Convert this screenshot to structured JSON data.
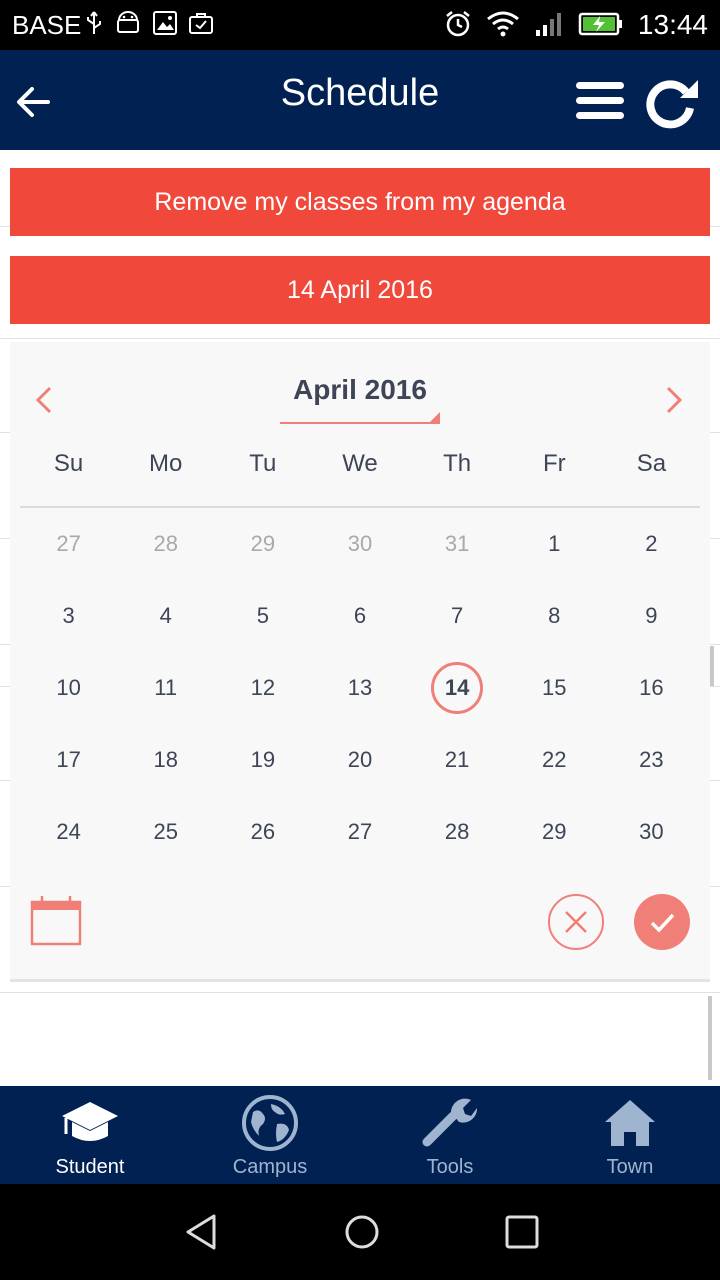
{
  "status_bar": {
    "carrier": "BASE",
    "time": "13:44",
    "icons": [
      "usb-icon",
      "android-icon",
      "image-icon",
      "briefcase-icon",
      "alarm-icon",
      "wifi-icon",
      "signal-icon",
      "battery-charging-icon"
    ]
  },
  "app_bar": {
    "title": "Schedule",
    "back_icon": "arrow-left-icon",
    "menu_icon": "hamburger-icon",
    "refresh_icon": "refresh-icon",
    "background": "#002152"
  },
  "actions": {
    "remove_label": "Remove my classes from my agenda",
    "date_label": "14 April 2016",
    "accent": "#f0483b"
  },
  "calendar": {
    "month_label": "April 2016",
    "weekdays": [
      "Su",
      "Mo",
      "Tu",
      "We",
      "Th",
      "Fr",
      "Sa"
    ],
    "weeks": [
      [
        "27",
        "28",
        "29",
        "30",
        "31",
        "1",
        "2"
      ],
      [
        "3",
        "4",
        "5",
        "6",
        "7",
        "8",
        "9"
      ],
      [
        "10",
        "11",
        "12",
        "13",
        "14",
        "15",
        "16"
      ],
      [
        "17",
        "18",
        "19",
        "20",
        "21",
        "22",
        "23"
      ],
      [
        "24",
        "25",
        "26",
        "27",
        "28",
        "29",
        "30"
      ]
    ],
    "muted_first_row_count": 5,
    "selected_day": "14",
    "highlight_color": "#f07f78"
  },
  "bottom_nav": {
    "items": [
      {
        "label": "Student",
        "icon": "graduation-cap-icon",
        "active": true
      },
      {
        "label": "Campus",
        "icon": "globe-icon",
        "active": false
      },
      {
        "label": "Tools",
        "icon": "wrench-icon",
        "active": false
      },
      {
        "label": "Town",
        "icon": "home-icon",
        "active": false
      }
    ]
  },
  "system_nav": [
    "back-triangle-icon",
    "home-circle-icon",
    "recent-square-icon"
  ]
}
